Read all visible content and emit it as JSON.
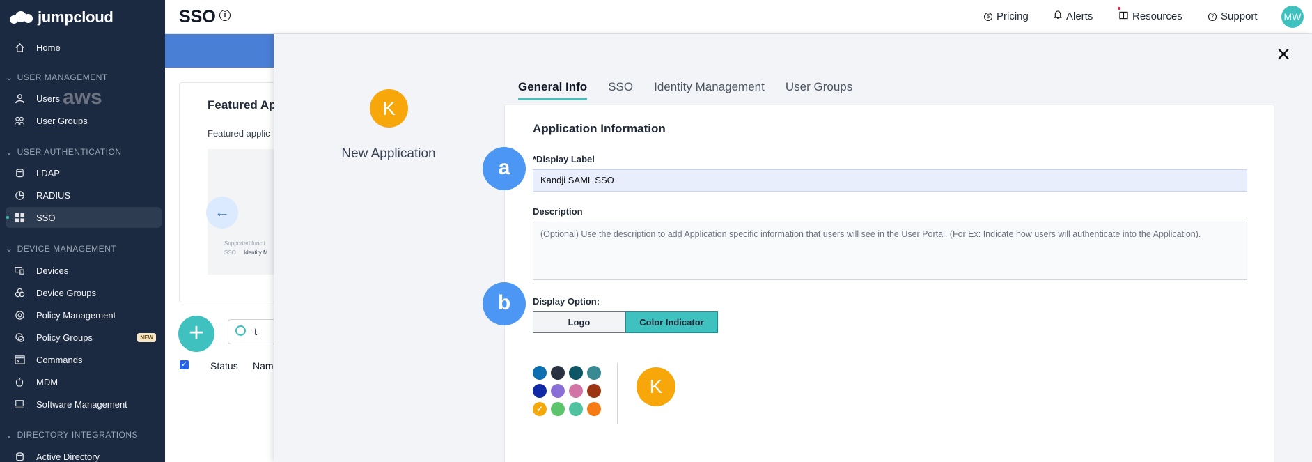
{
  "brand": {
    "name": "jumpcloud"
  },
  "sidebar": {
    "home": "Home",
    "sections": [
      {
        "label": "USER MANAGEMENT"
      },
      {
        "label": "USER AUTHENTICATION"
      },
      {
        "label": "DEVICE MANAGEMENT"
      },
      {
        "label": "DIRECTORY INTEGRATIONS"
      }
    ],
    "items": [
      {
        "label": "Users"
      },
      {
        "label": "User Groups"
      },
      {
        "label": "LDAP"
      },
      {
        "label": "RADIUS"
      },
      {
        "label": "SSO"
      },
      {
        "label": "Devices"
      },
      {
        "label": "Device Groups"
      },
      {
        "label": "Policy Management"
      },
      {
        "label": "Policy Groups",
        "badge": "NEW"
      },
      {
        "label": "Commands"
      },
      {
        "label": "MDM"
      },
      {
        "label": "Software Management"
      },
      {
        "label": "Active Directory"
      }
    ]
  },
  "header": {
    "title": "SSO",
    "links": [
      "Pricing",
      "Alerts",
      "Resources",
      "Support"
    ],
    "avatar": "MW"
  },
  "background": {
    "card_title": "Featured Ap",
    "card_subtitle": "Featured applic",
    "aws_text": "aws",
    "tile_line1": "Supported functi",
    "tile_line2a": "SSO",
    "tile_line2b": "Identity M",
    "search_value": "t",
    "columns": [
      "Status",
      "Nam"
    ]
  },
  "modal": {
    "app_initial": "K",
    "app_title": "New Application",
    "tabs": [
      "General Info",
      "SSO",
      "Identity Management",
      "User Groups"
    ],
    "section_title": "Application Information",
    "display_label_label": "*Display Label",
    "display_label_value": "Kandji SAML SSO",
    "description_label": "Description",
    "description_placeholder": "(Optional) Use the description to add Application specific information that users will see in the User Portal. (For Ex: Indicate how users will authenticate into the Application).",
    "display_option_label": "Display Option:",
    "options": [
      "Logo",
      "Color Indicator"
    ],
    "selected_option": "Color Indicator",
    "swatch_colors": [
      "#0b6fb0",
      "#2a3140",
      "#0e5566",
      "#3a8a94",
      "#1029a6",
      "#8a6fd6",
      "#d274a6",
      "#9d3412",
      "#f5a80a",
      "#5cc46b",
      "#4fc3a0",
      "#f57b14"
    ],
    "selected_swatch_index": 8,
    "preview_initial": "K",
    "step_markers": [
      "a",
      "b"
    ],
    "accent_color": "#3fc1c0"
  }
}
